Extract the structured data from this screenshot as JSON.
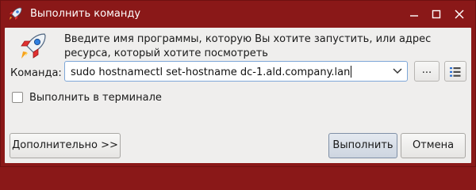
{
  "window": {
    "title": "Выполнить команду",
    "minimize_icon": "minimize-icon",
    "maximize_icon": "maximize-icon",
    "close_icon": "close-icon",
    "accent": "#8a1818"
  },
  "description": {
    "line1": "Введите имя программы, которую Вы хотите запустить, или адрес",
    "line2": "ресурса, который хотите посмотреть"
  },
  "command": {
    "label": "Команда:",
    "value": "sudo hostnamectl set-hostname dc-1.ald.company.lan",
    "browse_label": "...",
    "list_icon": "list-icon"
  },
  "terminal_option": {
    "label": "Выполнить в терминале",
    "checked": false
  },
  "buttons": {
    "advanced": "Дополнительно >>",
    "run": "Выполнить",
    "cancel": "Отмена"
  }
}
